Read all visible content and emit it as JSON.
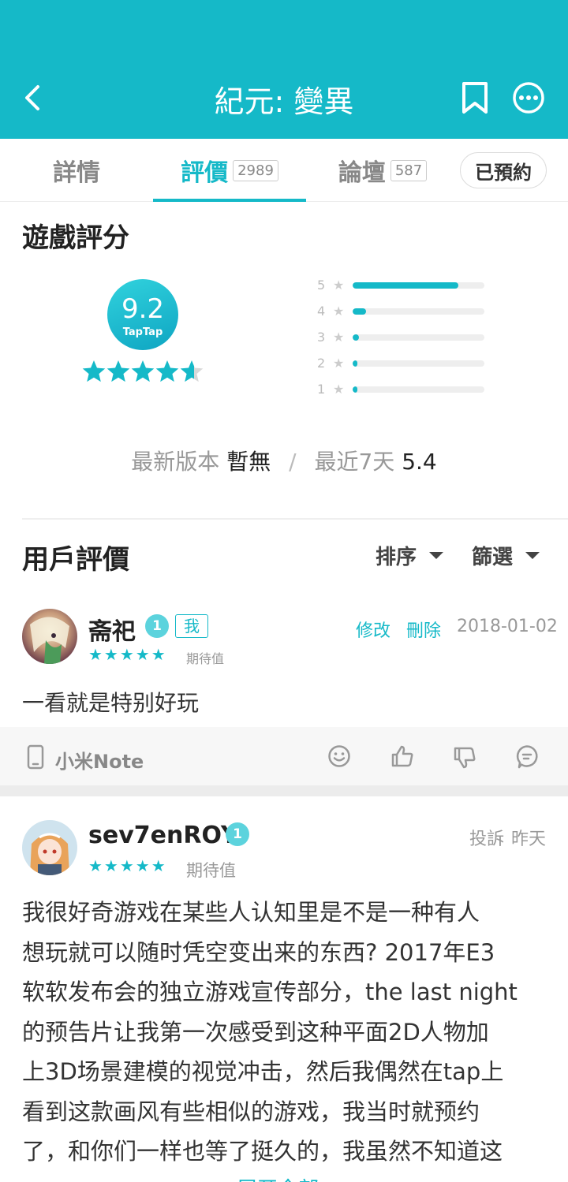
{
  "header": {
    "title": "紀元: 變異",
    "bg_color": "#15b9c8"
  },
  "tabs": [
    {
      "label": "詳情",
      "count": null,
      "active": false
    },
    {
      "label": "評價",
      "count": "2989",
      "active": true
    },
    {
      "label": "論壇",
      "count": "587",
      "active": false
    }
  ],
  "reserved_label": "已預約",
  "rating": {
    "section_title": "遊戲評分",
    "score": "9.2",
    "brand": "TapTap",
    "stars": 4.6,
    "distribution": [
      {
        "label": "5",
        "fraction": 0.8
      },
      {
        "label": "4",
        "fraction": 0.1
      },
      {
        "label": "3",
        "fraction": 0.045
      },
      {
        "label": "2",
        "fraction": 0.015
      },
      {
        "label": "1",
        "fraction": 0.035
      }
    ],
    "latest_version_label": "最新版本",
    "latest_version_value": "暫無",
    "separator": "/",
    "recent_label": "最近7天",
    "recent_value": "5.4"
  },
  "user_reviews": {
    "section_title": "用戶評價",
    "sort_label": "排序",
    "filter_label": "篩選"
  },
  "review1": {
    "username": "斋祀",
    "level": "1",
    "me_tag": "我",
    "stars": 5,
    "expect_label": "期待值",
    "edit_label": "修改",
    "delete_label": "刪除",
    "date": "2018-01-02",
    "text": "一看就是特别好玩",
    "device": "小米Note"
  },
  "review2": {
    "username": "sev7enROY",
    "level": "1",
    "stars": 5,
    "expect_label": "期待值",
    "report_label": "投訴",
    "date": "昨天",
    "text": "我很好奇游戏在某些人认知里是不是一种有人\n想玩就可以随时凭空变出来的东西? 2017年E3\n软软发布会的独立游戏宣传部分，the last night\n的预告片让我第一次感受到这种平面2D人物加\n上3D场景建模的视觉冲击，然后我偶然在tap上\n看到这款画风有些相似的游戏，我当时就预约\n了，和你们一样也等了挺久的，我虽然不知道这",
    "more_label": "展开全部"
  }
}
